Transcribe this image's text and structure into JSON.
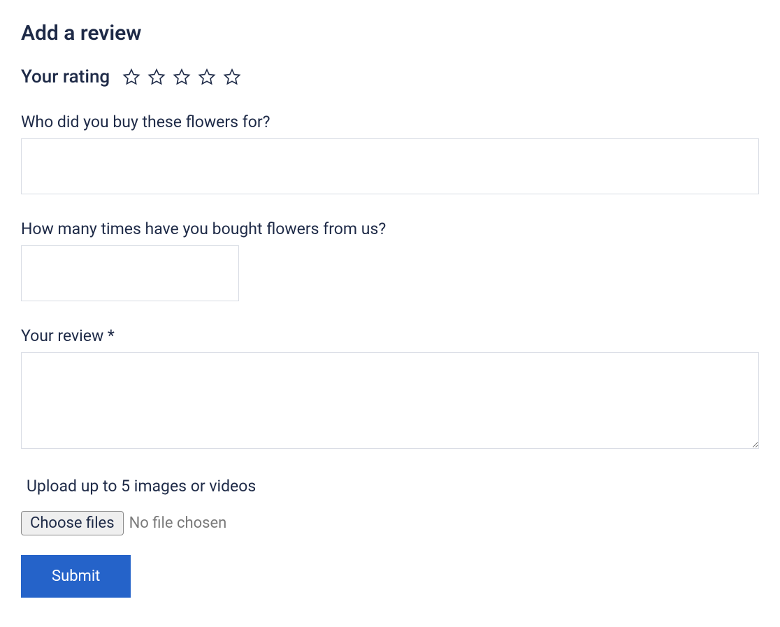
{
  "heading": "Add a review",
  "rating": {
    "label": "Your rating",
    "stars": 5
  },
  "fields": {
    "recipient": {
      "label": "Who did you buy these flowers for?",
      "value": ""
    },
    "purchase_count": {
      "label": "How many times have you bought flowers from us?",
      "value": ""
    },
    "review": {
      "label": "Your review *",
      "value": ""
    }
  },
  "upload": {
    "label": "Upload up to 5 images or videos",
    "button": "Choose files",
    "status": "No file chosen"
  },
  "submit": {
    "label": "Submit"
  }
}
